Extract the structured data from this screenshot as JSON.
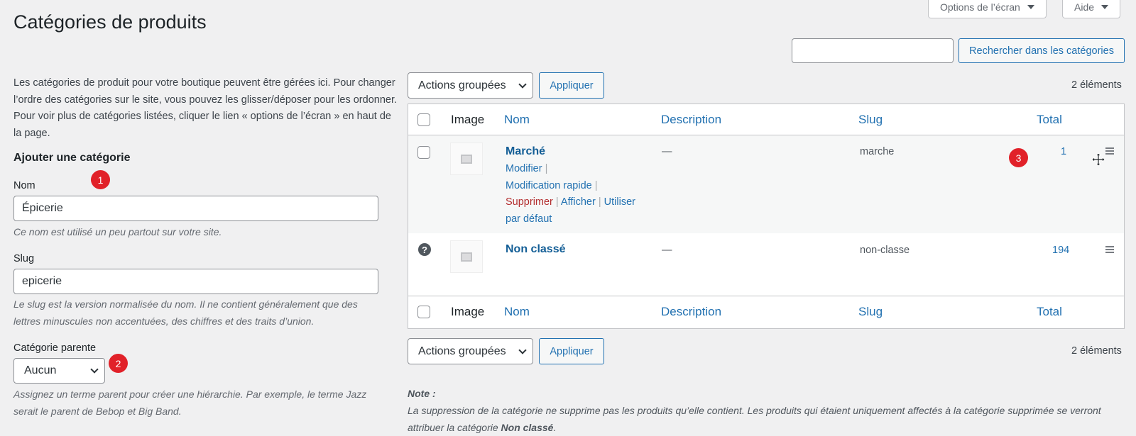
{
  "page": {
    "title": "Catégories de produits"
  },
  "screen_options": {
    "label": "Options de l’écran",
    "help_label": "Aide"
  },
  "search": {
    "value": "",
    "button_label": "Rechercher dans les catégories"
  },
  "intro": "Les catégories de produit pour votre boutique peuvent être gérées ici. Pour changer l’ordre des catégories sur le site, vous pouvez les glisser/déposer pour les ordonner. Pour voir plus de catégories listées, cliquer le lien « options de l’écran » en haut de la page.",
  "form": {
    "heading": "Ajouter une catégorie",
    "name_label": "Nom",
    "name_value": "Épicerie",
    "name_help": "Ce nom est utilisé un peu partout sur votre site.",
    "slug_label": "Slug",
    "slug_value": "epicerie",
    "slug_help": "Le slug est la version normalisée du nom. Il ne contient généralement que des lettres minuscules non accentuées, des chiffres et des traits d’union.",
    "parent_label": "Catégorie parente",
    "parent_value": "Aucun",
    "parent_help": "Assignez un terme parent pour créer une hiérarchie. Par exemple, le terme Jazz serait le parent de Bebop et Big Band."
  },
  "badges": [
    "1",
    "2",
    "3"
  ],
  "bulk": {
    "select_label": "Actions groupées",
    "apply_label": "Appliquer",
    "count_label": "2 éléments"
  },
  "table": {
    "columns": {
      "image": "Image",
      "name": "Nom",
      "description": "Description",
      "slug": "Slug",
      "total": "Total"
    },
    "rows": [
      {
        "name": "Marché",
        "description": "—",
        "slug": "marche",
        "total": "1",
        "actions": {
          "edit": "Modifier",
          "quick_edit": "Modification rapide",
          "delete": "Supprimer",
          "view": "Afficher",
          "default_1": "Utiliser",
          "default_2": "par défaut"
        }
      },
      {
        "name": "Non classé",
        "description": "—",
        "slug": "non-classe",
        "total": "194",
        "status_icon": "?"
      }
    ]
  },
  "note": {
    "title": "Note :",
    "text_part1": "La suppression de la catégorie ne supprime pas les produits qu’elle contient. Les produits qui étaient uniquement affectés à la catégorie supprimée se verront attribuer la catégorie ",
    "text_bold": "Non classé",
    "text_part2": "."
  }
}
